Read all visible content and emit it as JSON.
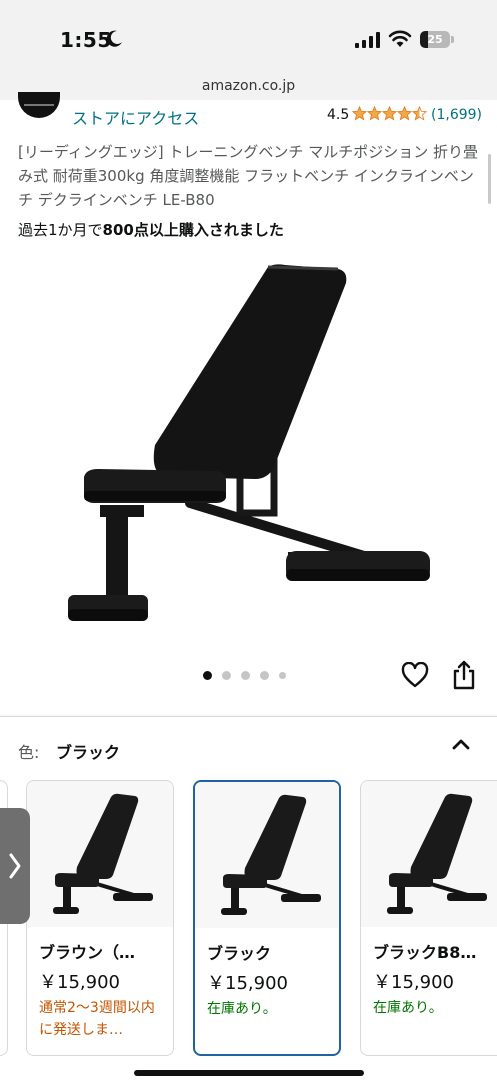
{
  "status_bar": {
    "time": "1:55",
    "battery_level": "25",
    "icons": [
      "moon-icon",
      "signal-icon",
      "wifi-icon",
      "battery-icon"
    ]
  },
  "url_bar": {
    "domain": "amazon.co.jp"
  },
  "store": {
    "link": "ストアにアクセス",
    "rating": "4.5",
    "rating_stars": 4.5,
    "rating_count": "(1,699)"
  },
  "product": {
    "title": "[リーディングエッジ] トレーニングベンチ マルチポジション 折り畳み式 耐荷重300kg 角度調整機能 フラットベンチ インクラインベンチ デクラインベンチ LE-B80",
    "bought_prefix": "過去1か月で",
    "bought_bold": "800点以上購入されました",
    "image_count": 5,
    "active_image_index": 0
  },
  "variant_selector": {
    "label": "色:",
    "selected": "ブラック",
    "options": [
      {
        "name": "ブラウン（…",
        "price": "￥15,900",
        "status": "通常2〜3週間以内に発送しま…",
        "status_color": "#c45500",
        "selected": false
      },
      {
        "name": "ブラック",
        "price": "￥15,900",
        "status": "在庫あり。",
        "status_color": "#007600",
        "selected": true
      },
      {
        "name": "ブラックB8…",
        "price": "￥15,900",
        "status": "在庫あり。",
        "status_color": "#007600",
        "selected": false
      }
    ]
  },
  "colors": {
    "link": "#007185",
    "star": "#f3a847",
    "selected_border": "#2162a1",
    "in_stock": "#007600",
    "delayed": "#c45500"
  }
}
